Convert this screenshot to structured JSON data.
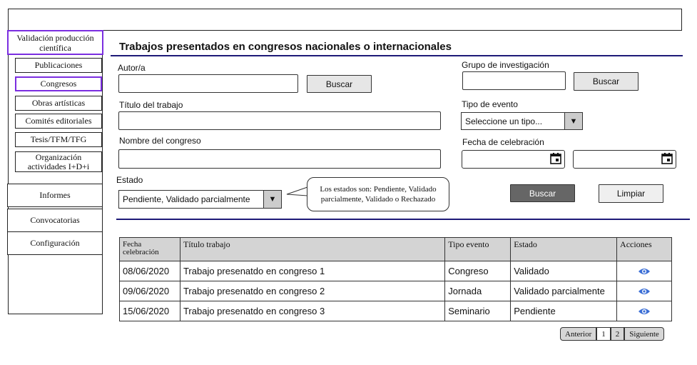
{
  "sidebar": {
    "header": "Validación producción científica",
    "subitems": [
      "Publicaciones",
      "Congresos",
      "Obras artísticas",
      "Comités editoriales",
      "Tesis/TFM/TFG",
      "Organización actividades I+D+i"
    ],
    "items": [
      "Informes",
      "Convocatorias",
      "Configuración"
    ]
  },
  "page": {
    "title": "Trabajos presentados en congresos nacionales o internacionales"
  },
  "filters": {
    "autor_label": "Autor/a",
    "autor_search": "Buscar",
    "grupo_label": "Grupo de investigación",
    "grupo_search": "Buscar",
    "titulo_label": "Título del trabajo",
    "tipo_label": "Tipo de evento",
    "tipo_value": "Seleccione un tipo...",
    "congreso_label": "Nombre del congreso",
    "fecha_label": "Fecha de celebración",
    "estado_label": "Estado",
    "estado_value": "Pendiente, Validado parcialmente",
    "estado_note": "Los estados son: Pendiente, Validado parcialmente, Validado o Rechazado",
    "search_button": "Buscar",
    "clear_button": "Limpiar"
  },
  "table": {
    "headers": [
      "Fecha celebración",
      "Título trabajo",
      "Tipo evento",
      "Estado",
      "Acciones"
    ],
    "rows": [
      {
        "fecha": "08/06/2020",
        "titulo": "Trabajo presenatdo en congreso 1",
        "tipo": "Congreso",
        "estado": "Validado"
      },
      {
        "fecha": "09/06/2020",
        "titulo": "Trabajo presenatdo en congreso 2",
        "tipo": "Jornada",
        "estado": "Validado parcialmente"
      },
      {
        "fecha": "15/06/2020",
        "titulo": "Trabajo presenatdo en congreso 3",
        "tipo": "Seminario",
        "estado": "Pendiente"
      }
    ]
  },
  "pagination": {
    "prev": "Anterior",
    "pages": [
      "1",
      "2"
    ],
    "next": "Siguiente"
  },
  "colors": {
    "accent_purple": "#7b2ee0",
    "rule_navy": "#1e1a78",
    "eye_icon": "#3c6fd6"
  },
  "icons": {
    "date": "calendar-icon",
    "select": "dropdown-arrow-icon",
    "view": "eye-icon"
  }
}
